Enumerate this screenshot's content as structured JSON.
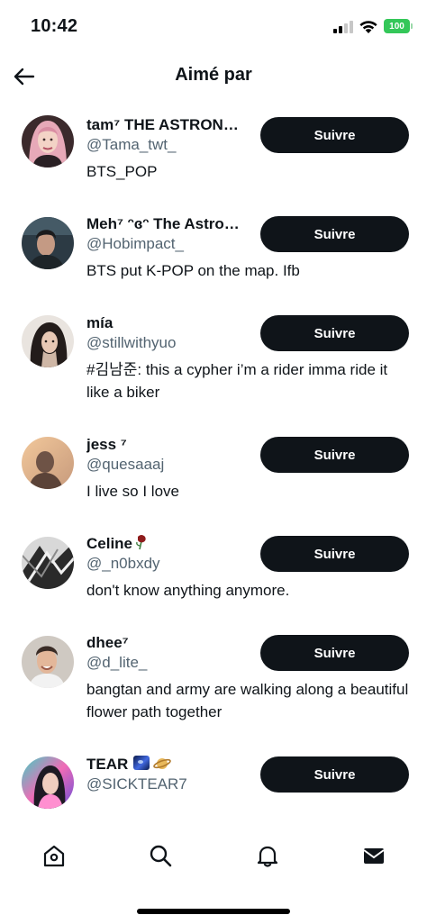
{
  "status_bar": {
    "time": "10:42",
    "battery": "100"
  },
  "header": {
    "title": "Aimé par"
  },
  "users": [
    {
      "name": "tam⁷ THE ASTRON…",
      "handle": "@Tama_twt_",
      "bio": "BTS_POP",
      "follow_label": "Suivre",
      "avatar": "portrait-pink-hair"
    },
    {
      "name": "Meh⁷ ᵔɞᵔ The Astro…",
      "handle": "@Hobimpact_",
      "bio": "BTS put K-POP on the map. Ifb",
      "follow_label": "Suivre",
      "avatar": "portrait-man"
    },
    {
      "name": "mía",
      "handle": "@stillwithyuo",
      "bio": "#김남준: this a cypher i’m a rider imma ride it like a biker",
      "follow_label": "Suivre",
      "avatar": "portrait-dark-hair"
    },
    {
      "name": "jess ⁷",
      "handle": "@quesaaaj",
      "bio": "I live so I love",
      "follow_label": "Suivre",
      "avatar": "silhouette-sunset"
    },
    {
      "name": "Celine",
      "handle": "@_n0bxdy",
      "bio": "don't know anything anymore.",
      "follow_label": "Suivre",
      "avatar": "bw-abstract"
    },
    {
      "name": "dhee⁷",
      "handle": "@d_lite_",
      "bio": "bangtan and army are walking along a beautiful flower path together",
      "follow_label": "Suivre",
      "avatar": "portrait-smiling"
    },
    {
      "name": "TEAR",
      "handle": "@SICKTEAR7",
      "bio": "",
      "follow_label": "Suivre",
      "avatar": "portrait-colorful"
    }
  ],
  "nav": {
    "items": [
      {
        "icon": "home-icon"
      },
      {
        "icon": "search-icon"
      },
      {
        "icon": "bell-icon"
      },
      {
        "icon": "mail-icon"
      }
    ]
  }
}
